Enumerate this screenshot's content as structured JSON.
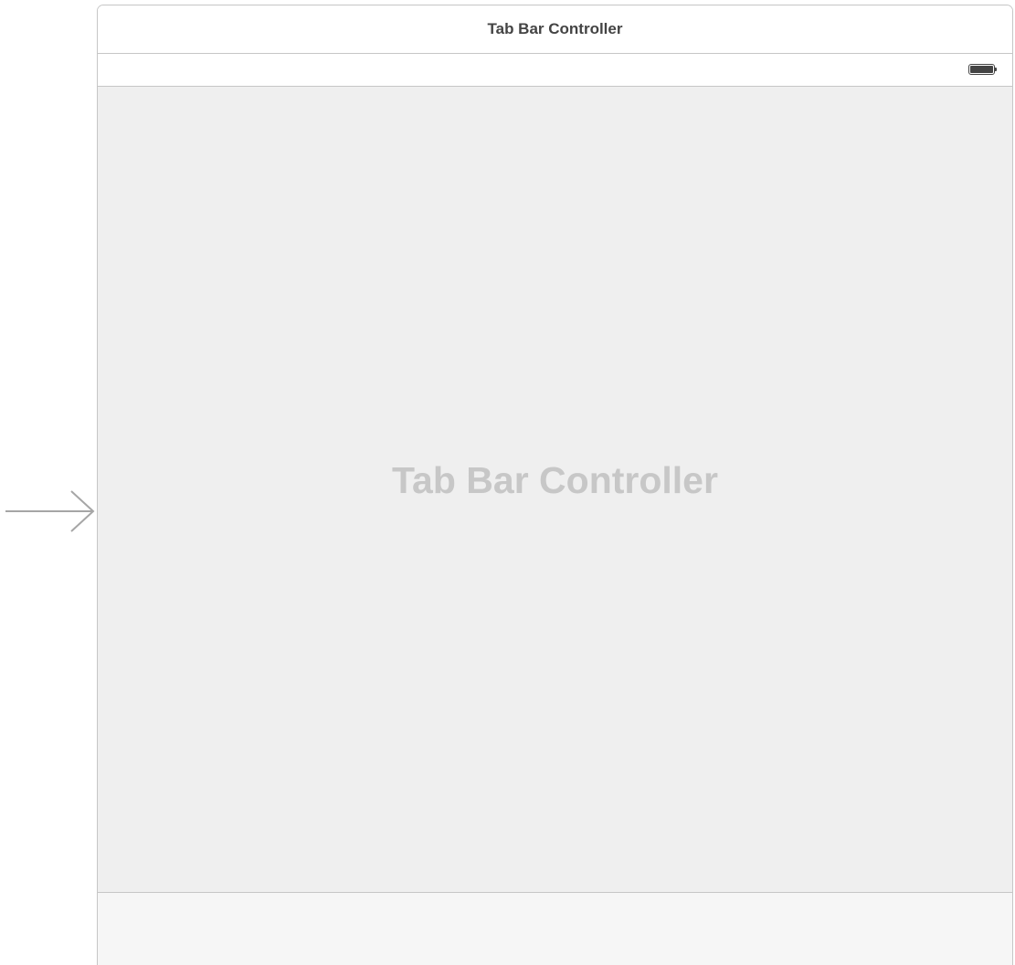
{
  "scene": {
    "title": "Tab Bar Controller"
  },
  "content": {
    "placeholder": "Tab Bar Controller"
  },
  "status_bar": {
    "battery_icon": "battery-icon"
  },
  "colors": {
    "content_background": "#efefef",
    "tab_bar_background": "#f6f6f6",
    "border": "#c6c6c6",
    "placeholder_text": "#c7c7c7",
    "title_text": "#444444"
  }
}
